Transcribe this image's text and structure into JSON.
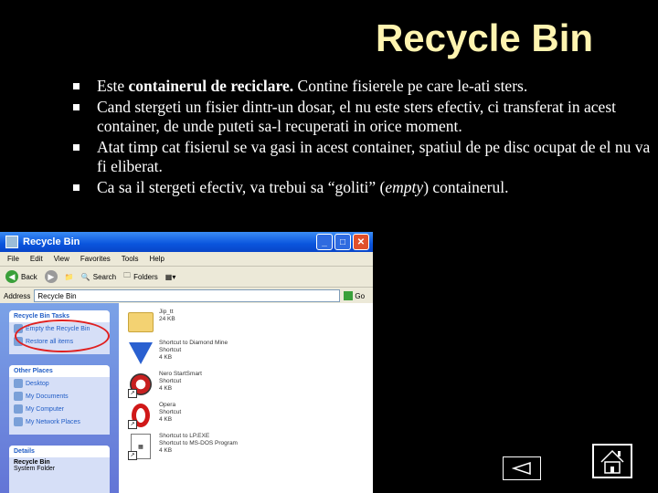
{
  "title": "Recycle Bin",
  "bullets": {
    "b1_pre": "Este ",
    "b1_bold": "containerul de reciclare.",
    "b1_post": " Contine fisierele pe care le-ati sters.",
    "b2": "Cand stergeti un fisier dintr-un dosar, el nu este sters efectiv, ci transferat in acest container, de unde puteti sa-l recuperati in orice moment.",
    "b3": "Atat timp cat fisierul se va gasi in acest container, spatiul de pe disc ocupat de el nu va fi eliberat.",
    "b4_pre": "Ca sa il stergeti efectiv, va trebui sa “goliti” (",
    "b4_italic": "empty",
    "b4_post": ") containerul."
  },
  "window": {
    "title": "Recycle Bin",
    "menu": [
      "File",
      "Edit",
      "View",
      "Favorites",
      "Tools",
      "Help"
    ],
    "toolbar": {
      "back": "Back",
      "search": "Search",
      "folders": "Folders"
    },
    "address_label": "Address",
    "address_value": "Recycle Bin",
    "go_label": "Go",
    "left": {
      "tasks_header": "Recycle Bin Tasks",
      "tasks": [
        "Empty the Recycle Bin",
        "Restore all items"
      ],
      "places_header": "Other Places",
      "places": [
        "Desktop",
        "My Documents",
        "My Computer",
        "My Network Places"
      ],
      "details_header": "Details",
      "details_title": "Recycle Bin",
      "details_sub": "System Folder"
    },
    "items": [
      {
        "name": "Jip_tt",
        "meta": "24 KB",
        "icon": "folder-icon"
      },
      {
        "name": "Shortcut to Diamond Mine",
        "meta": "Shortcut\n4 KB",
        "icon": "diamond-icon"
      },
      {
        "name": "Nero StartSmart",
        "meta": "Shortcut\n4 KB",
        "icon": "nero-icon"
      },
      {
        "name": "Opera",
        "meta": "Shortcut\n4 KB",
        "icon": "opera-icon"
      },
      {
        "name": "Shortcut to LP.EXE",
        "meta": "Shortcut to MS-DOS Program\n4 KB",
        "icon": "msdos-icon"
      }
    ]
  },
  "nav": {
    "prev_icon": "back-arrow-icon",
    "home_icon": "home-icon"
  }
}
